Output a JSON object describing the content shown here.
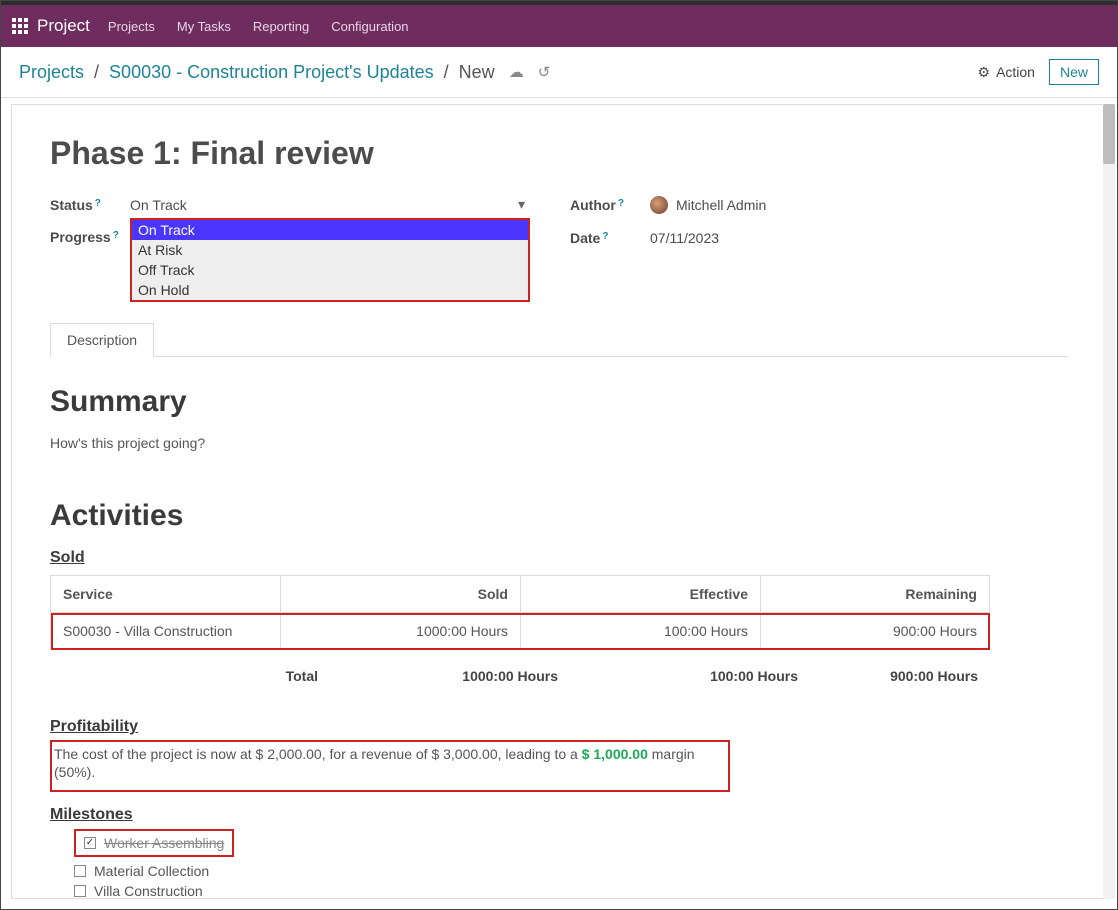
{
  "topbar": {
    "brand": "Project",
    "nav": [
      "Projects",
      "My Tasks",
      "Reporting",
      "Configuration"
    ]
  },
  "breadcrumb": {
    "link1": "Projects",
    "link2": "S00030 - Construction Project's Updates",
    "current": "New"
  },
  "actions": {
    "action_label": "Action",
    "new_label": "New"
  },
  "page": {
    "title": "Phase 1: Final review"
  },
  "form": {
    "status_label": "Status",
    "status_value": "On Track",
    "status_options": [
      "On Track",
      "At Risk",
      "Off Track",
      "On Hold"
    ],
    "progress_label": "Progress",
    "author_label": "Author",
    "author_value": "Mitchell Admin",
    "date_label": "Date",
    "date_value": "07/11/2023"
  },
  "tabs": {
    "description": "Description"
  },
  "summary": {
    "heading": "Summary",
    "question": "How's this project going?"
  },
  "activities": {
    "heading": "Activities",
    "sold_heading": "Sold",
    "columns": [
      "Service",
      "Sold",
      "Effective",
      "Remaining"
    ],
    "row": {
      "service": "S00030 - Villa Construction",
      "sold": "1000:00 Hours",
      "effective": "100:00 Hours",
      "remaining": "900:00 Hours"
    },
    "total_label": "Total",
    "total": {
      "sold": "1000:00 Hours",
      "effective": "100:00 Hours",
      "remaining": "900:00 Hours"
    }
  },
  "profitability": {
    "heading": "Profitability",
    "pre": "The cost of the project is now at $ 2,000.00, for a revenue of $ 3,000.00, leading to a ",
    "margin": "$ 1,000.00",
    "post": " margin (50%)."
  },
  "milestones": {
    "heading": "Milestones",
    "items": [
      {
        "label": "Worker Assembling",
        "checked": true
      },
      {
        "label": "Material Collection",
        "checked": false
      },
      {
        "label": "Villa Construction",
        "checked": false
      }
    ]
  }
}
